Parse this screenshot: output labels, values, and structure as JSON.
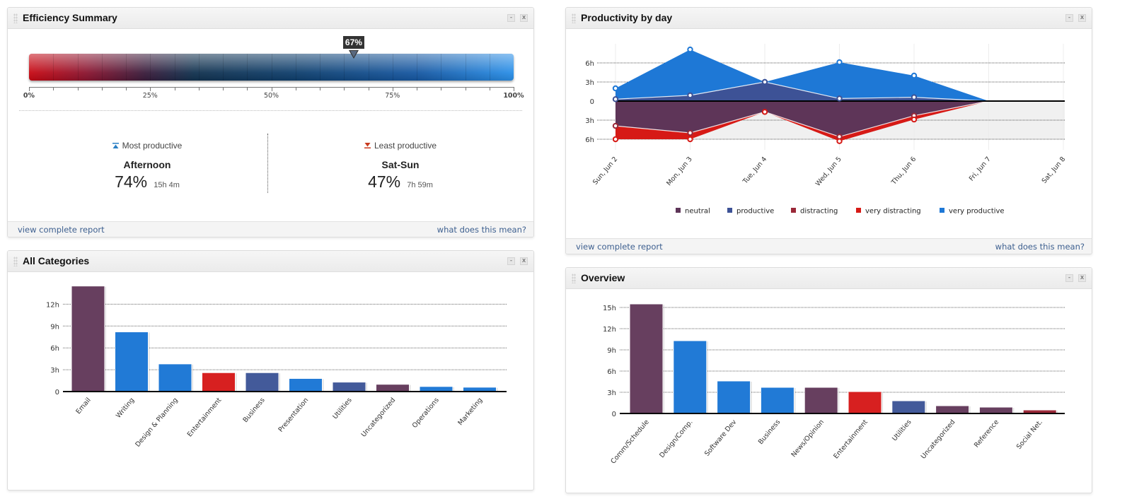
{
  "efficiency": {
    "title": "Efficiency Summary",
    "value_percent": 67,
    "marker_label": "67%",
    "scale_labels": [
      "0%",
      "25%",
      "50%",
      "75%",
      "100%"
    ],
    "most": {
      "heading": "Most productive",
      "name": "Afternoon",
      "percent": "74%",
      "time": "15h 4m",
      "icon_color": "#2a7fc4"
    },
    "least": {
      "heading": "Least productive",
      "name": "Sat-Sun",
      "percent": "47%",
      "time": "7h 59m",
      "icon_color": "#c83a1e"
    },
    "footer_left": "view complete report",
    "footer_right": "what does this mean?"
  },
  "productivity": {
    "title": "Productivity by day",
    "footer_left": "view complete report",
    "footer_right": "what does this mean?"
  },
  "categories": {
    "title": "All Categories"
  },
  "overview": {
    "title": "Overview"
  },
  "window_buttons": {
    "minimize": "-",
    "close": "x"
  },
  "colors": {
    "neutral": "#5e3558",
    "productive": "#3d5296",
    "distracting": "#9a2838",
    "very_distracting": "#d61a16",
    "very_productive": "#1e78d6"
  },
  "chart_data": [
    {
      "id": "productivity_by_day",
      "type": "area",
      "title": "Productivity by day",
      "x": [
        "Sun, Jun 2",
        "Mon, Jun 3",
        "Tue, Jun 4",
        "Wed, Jun 5",
        "Thu, Jun 6",
        "Fri, Jun 7",
        "Sat, Jun 8"
      ],
      "yticks": [
        {
          "value": 6,
          "label": "6h"
        },
        {
          "value": 3,
          "label": "3h"
        },
        {
          "value": 0,
          "label": "0"
        },
        {
          "value": -3,
          "label": "3h"
        },
        {
          "value": -6,
          "label": "6h"
        }
      ],
      "ylim": [
        -6.5,
        8.5
      ],
      "unit": "hours",
      "series": [
        {
          "name": "neutral",
          "color": "#5e3558",
          "direction": "down",
          "values": [
            3.9,
            5.0,
            1.7,
            5.6,
            2.3,
            0,
            null
          ]
        },
        {
          "name": "productive",
          "color": "#3d5296",
          "direction": "up",
          "values": [
            0.3,
            0.9,
            3.0,
            0.4,
            0.6,
            0,
            null
          ]
        },
        {
          "name": "distracting",
          "color": "#9a2838",
          "direction": "down",
          "values": [
            0.0,
            0.0,
            0.0,
            0.0,
            0.0,
            0,
            null
          ]
        },
        {
          "name": "very distracting",
          "color": "#d61a16",
          "direction": "down",
          "values": [
            2.1,
            1.0,
            0.0,
            0.7,
            0.6,
            0,
            null
          ]
        },
        {
          "name": "very productive",
          "color": "#1e78d6",
          "direction": "up",
          "values": [
            1.7,
            7.2,
            0.0,
            5.7,
            3.4,
            0,
            null
          ]
        }
      ],
      "legend": [
        "neutral",
        "productive",
        "distracting",
        "very distracting",
        "very productive"
      ],
      "legend_position": "bottom",
      "grid": true
    },
    {
      "id": "all_categories",
      "type": "bar",
      "title": "All Categories",
      "categories": [
        "Email",
        "Writing",
        "Design & Planning",
        "Entertainment",
        "Business",
        "Presentation",
        "Utilities",
        "Uncategorized",
        "Operations",
        "Marketing"
      ],
      "values": [
        14.5,
        8.2,
        3.8,
        2.6,
        2.6,
        1.8,
        1.3,
        1.0,
        0.7,
        0.6
      ],
      "colors": [
        "#673f5f",
        "#217ad6",
        "#217ad6",
        "#d72020",
        "#435a9a",
        "#217ad6",
        "#435a9a",
        "#673f5f",
        "#217ad6",
        "#217ad6"
      ],
      "yticks": [
        "0",
        "3h",
        "6h",
        "9h",
        "12h"
      ],
      "ytick_values": [
        0,
        3,
        6,
        9,
        12
      ],
      "ylim": [
        0,
        14.5
      ],
      "unit": "hours",
      "grid": true
    },
    {
      "id": "overview",
      "type": "bar",
      "title": "Overview",
      "categories": [
        "Comm/Schedule",
        "Design/Comp.",
        "Software Dev",
        "Business",
        "News/Opinion",
        "Entertainment",
        "Utilities",
        "Uncategorized",
        "Reference",
        "Social Net."
      ],
      "values": [
        15.5,
        10.3,
        4.6,
        3.7,
        3.7,
        3.1,
        1.8,
        1.1,
        0.9,
        0.5
      ],
      "colors": [
        "#673f5f",
        "#217ad6",
        "#217ad6",
        "#217ad6",
        "#673f5f",
        "#d72020",
        "#435a9a",
        "#673f5f",
        "#673f5f",
        "#9a2838"
      ],
      "yticks": [
        "0",
        "3h",
        "6h",
        "9h",
        "12h",
        "15h"
      ],
      "ytick_values": [
        0,
        3,
        6,
        9,
        12,
        15
      ],
      "ylim": [
        0,
        15.5
      ],
      "unit": "hours",
      "grid": true
    }
  ]
}
